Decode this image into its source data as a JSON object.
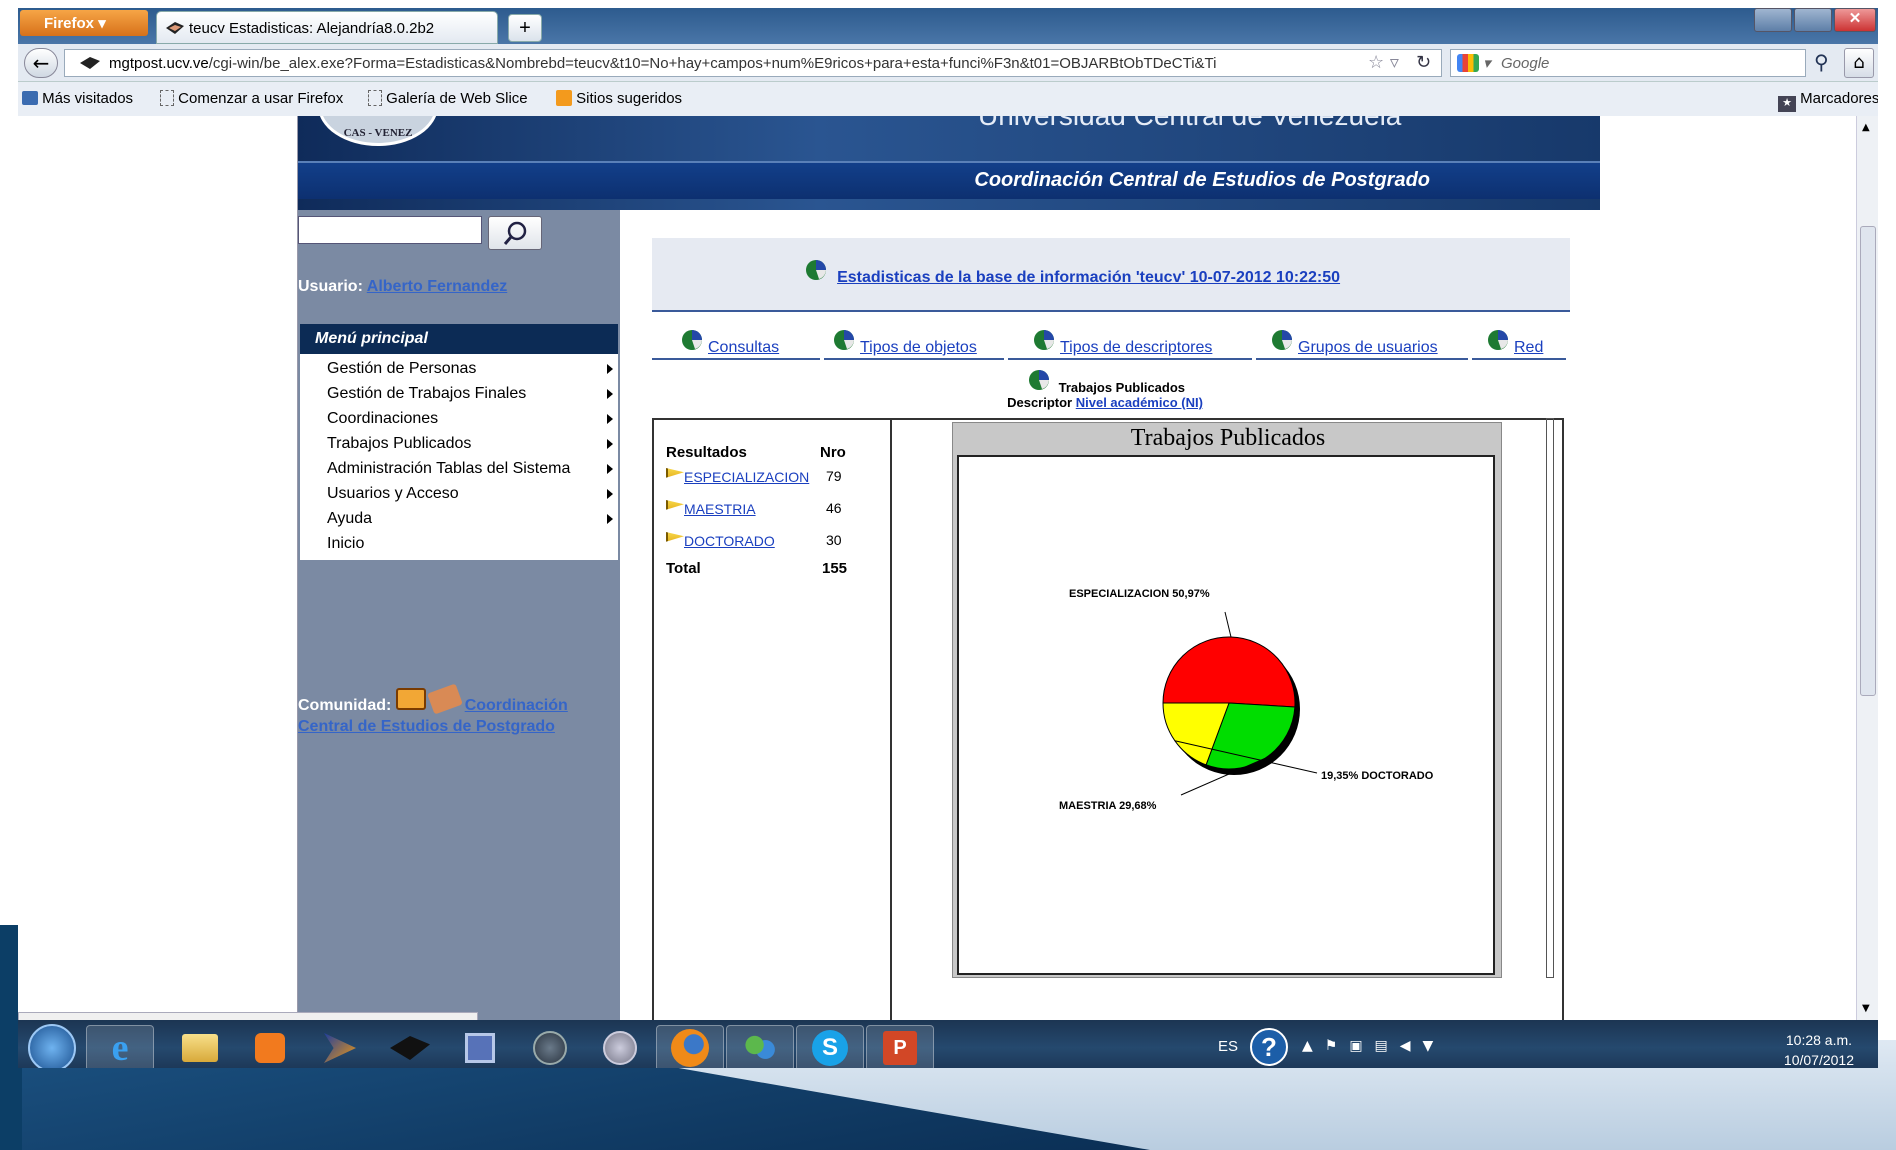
{
  "browser": {
    "menu_button": "Firefox",
    "tab_title": "teucv Estadisticas: Alejandría8.0.2b2",
    "new_tab": "+",
    "url_host": "mgtpost.ucv.ve",
    "url_path": "/cgi-win/be_alex.exe?Forma=Estadisticas&Nombrebd=teucv&t10=No+hay+campos+num%E9ricos+para+esta+funci%F3n&t01=OBJARBtObTDeCTi&Ti",
    "search_placeholder": "Google",
    "bookmarks": [
      "Más visitados",
      "Comenzar a usar Firefox",
      "Galería de Web Slice",
      "Sitios sugeridos"
    ],
    "bookmarks_menu": "Marcadores",
    "status_text": "javascript:MuestraOcultaFormaEstadisticas('IdEstadisticas01');"
  },
  "site": {
    "university": "Universidad Central de Venezuela",
    "seal_text": "CAS - VENEZ",
    "subheader": "Coordinación Central de Estudios de Postgrado"
  },
  "sidebar": {
    "usuario_label": "Usuario:",
    "usuario_name": "Alberto Fernandez",
    "menu_title": "Menú principal",
    "menu_items": [
      {
        "label": "Gestión de Personas",
        "has_submenu": true
      },
      {
        "label": "Gestión de Trabajos Finales",
        "has_submenu": true
      },
      {
        "label": "Coordinaciones",
        "has_submenu": true
      },
      {
        "label": "Trabajos Publicados",
        "has_submenu": true
      },
      {
        "label": "Administración Tablas del Sistema",
        "has_submenu": true
      },
      {
        "label": "Usuarios y Acceso",
        "has_submenu": true
      },
      {
        "label": "Ayuda",
        "has_submenu": true
      },
      {
        "label": "Inicio",
        "has_submenu": false
      }
    ],
    "comunidad_label": "Comunidad:",
    "comunidad_link": "Coordinación Central de Estudios de Postgrado"
  },
  "main": {
    "stats_title": "Estadisticas de la base de información 'teucv' 10-07-2012 10:22:50",
    "nav_links": [
      "Consultas",
      "Tipos de objetos",
      "Tipos de descriptores",
      "Grupos de usuarios",
      "Red"
    ],
    "report_title": "Trabajos Publicados",
    "descriptor_label": "Descriptor",
    "descriptor_value": "Nivel académico (NI)",
    "results": {
      "col_result": "Resultados",
      "col_nro": "Nro",
      "rows": [
        {
          "label": "ESPECIALIZACION",
          "nro": "79"
        },
        {
          "label": "MAESTRIA",
          "nro": "46"
        },
        {
          "label": "DOCTORADO",
          "nro": "30"
        }
      ],
      "total_label": "Total",
      "total_value": "155"
    }
  },
  "chart_data": {
    "type": "pie",
    "title": "Trabajos Publicados",
    "categories": [
      "ESPECIALIZACION",
      "MAESTRIA",
      "DOCTORADO"
    ],
    "values": [
      79,
      46,
      30
    ],
    "labels": [
      "ESPECIALIZACION 50,97%",
      "MAESTRIA 29,68%",
      "19,35% DOCTORADO"
    ],
    "colors": [
      "#ff0000",
      "#00dd00",
      "#ffff00"
    ]
  },
  "taskbar": {
    "language": "ES",
    "time": "10:28 a.m.",
    "date": "10/07/2012"
  }
}
